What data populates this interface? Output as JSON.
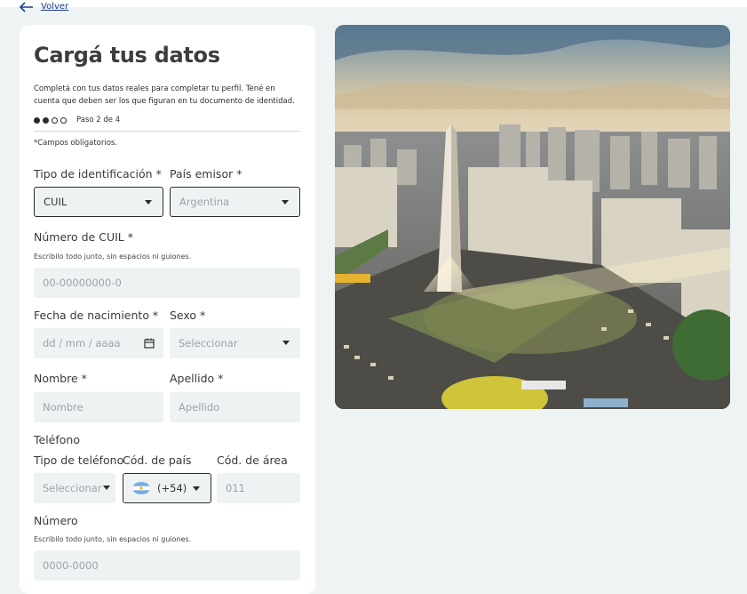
{
  "nav": {
    "back_label": "Volver"
  },
  "form": {
    "title": "Cargá tus datos",
    "description": "Completá con tus datos reales para completar tu perfil. Tené en cuenta que deben ser los que figuran en tu documento de identidad.",
    "step_label": "Paso 2 de 4",
    "required_note": "*Campos obligatorios.",
    "id_type": {
      "label": "Tipo de identificación *",
      "value": "CUIL"
    },
    "country_issuer": {
      "label": "País emisor *",
      "placeholder": "Argentina"
    },
    "cuil": {
      "label": "Número de CUIL *",
      "hint": "Escribilo todo junto, sin espacios ni guiones.",
      "placeholder": "00-00000000-0"
    },
    "birth_date": {
      "label": "Fecha de nacimiento *",
      "placeholder": "dd / mm / aaaa"
    },
    "sex": {
      "label": "Sexo *",
      "placeholder": "Seleccionar"
    },
    "first_name": {
      "label": "Nombre *",
      "placeholder": "Nombre"
    },
    "last_name": {
      "label": "Apellido *",
      "placeholder": "Apellido"
    },
    "phone": {
      "section_label": "Teléfono",
      "type_label": "Tipo de teléfono",
      "type_placeholder": "Seleccionar",
      "country_code_label": "Cód. de país",
      "country_code_value": "(+54)",
      "area_code_label": "Cód. de área",
      "area_code_placeholder": "011",
      "number_label": "Número",
      "number_hint": "Escribilo todo junto, sin espacios ni guiones.",
      "number_placeholder": "0000-0000"
    }
  },
  "colors": {
    "link": "#1a3d8f",
    "background": "#eef3f3",
    "field_bg": "#eef2f3",
    "border_dark": "#2b2b2b"
  },
  "icons": [
    "arrow-left-icon",
    "chevron-down-icon",
    "calendar-icon",
    "argentina-flag-icon"
  ]
}
